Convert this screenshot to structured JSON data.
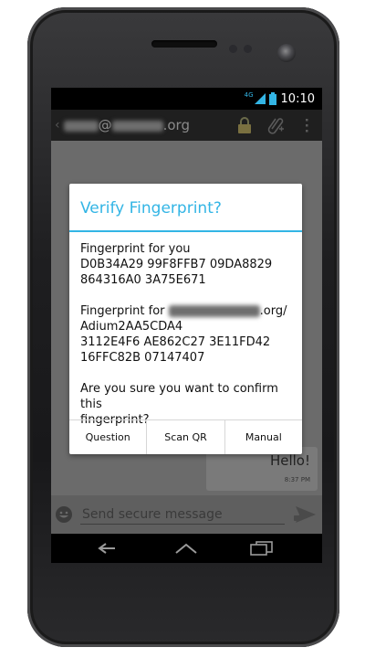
{
  "status_bar": {
    "network": "4G",
    "time": "10:10"
  },
  "action_bar": {
    "contact_suffix": "@",
    "contact_domain_suffix": ".org",
    "icons": [
      "lock-icon",
      "attach-icon",
      "overflow-menu-icon"
    ]
  },
  "dialog": {
    "title": "Verify Fingerprint?",
    "your_label": "Fingerprint for you",
    "your_fp_line1": "D0B34A29 99F8FFB7 09DA8829",
    "your_fp_line2": "864316A0 3A75E671",
    "their_label": "Fingerprint for",
    "their_domain_suffix": ".org/",
    "their_resource": "Adium2AA5CDA4",
    "their_fp_line1": "3112E4F6 AE862C27 3E11FD42",
    "their_fp_line2": "16FFC82B 07147407",
    "confirm_line1": "Are you sure you want to confirm this",
    "confirm_line2": "fingerprint?",
    "buttons": {
      "question": "Question",
      "scan_qr": "Scan QR",
      "manual": "Manual"
    }
  },
  "chat": {
    "message_text": "Hello!",
    "message_time": "8:37 PM"
  },
  "composer": {
    "placeholder": "Send secure message"
  },
  "colors": {
    "accent": "#33b5e5",
    "dim_overlay": "#6b6b6b",
    "action_bar": "#1f1f1f"
  }
}
